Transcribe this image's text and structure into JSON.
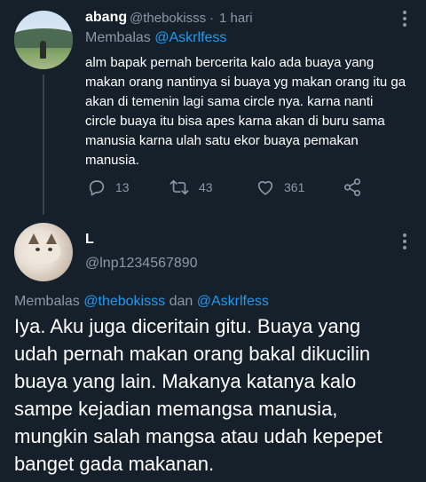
{
  "tweet": {
    "author_name": "abang",
    "handle": "@thebokisss",
    "separator": "·",
    "time": "1 hari",
    "replying_prefix": "Membalas",
    "replying_to": "@Askrlfess",
    "text_lines": [
      "alm bapak pernah bercerita kalo ada buaya yang",
      "makan orang nantinya si buaya yg makan orang itu ga",
      "akan di temenin lagi sama circle nya. karna nanti",
      "circle buaya itu bisa apes karna akan di buru sama",
      "manusia karna ulah satu ekor buaya pemakan",
      "manusia."
    ],
    "actions": {
      "reply_count": "13",
      "retweet_count": "43",
      "like_count": "361"
    }
  },
  "reply": {
    "author_name": "L",
    "handle": "@lnp1234567890",
    "replying_prefix": "Membalas",
    "replying_to_1": "@thebokisss",
    "replying_joiner": "dan",
    "replying_to_2": "@Askrlfess",
    "text_lines": [
      "Iya. Aku juga diceritain gitu. Buaya yang",
      "udah pernah makan orang bakal dikucilin",
      "buaya yang lain. Makanya katanya kalo",
      "sampe kejadian memangsa manusia,",
      "mungkin salah mangsa atau udah kepepet",
      "banget gada makanan."
    ]
  },
  "icons": {
    "reply": "reply-icon",
    "retweet": "retweet-icon",
    "like": "heart-icon",
    "share": "share-icon",
    "more": "more-icon"
  },
  "colors": {
    "background": "#15202b",
    "text": "#ffffff",
    "secondary": "#8b98a5",
    "link": "#1d9bf0",
    "thread_line": "#38444d"
  }
}
